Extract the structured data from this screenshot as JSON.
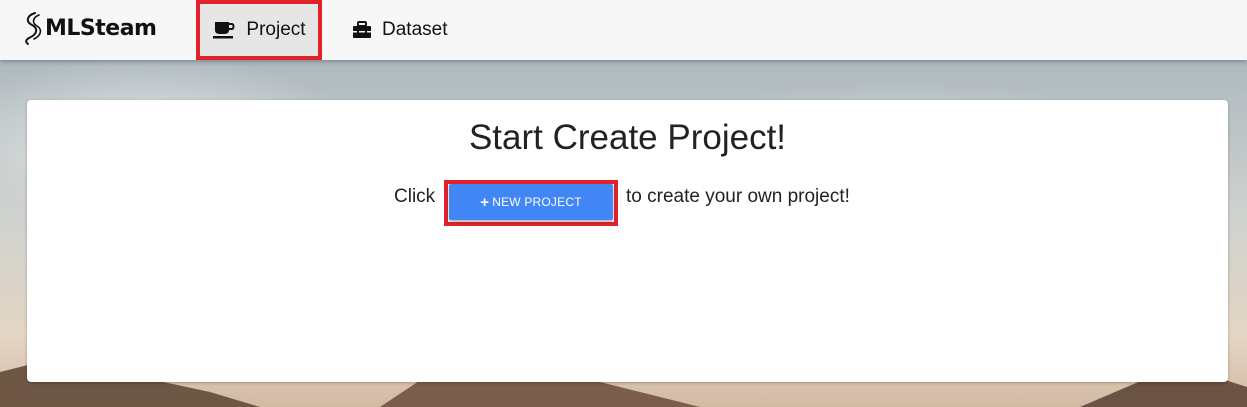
{
  "app": {
    "brand_name": "MLSteam",
    "brand_icon": "mlsteam-logo-icon"
  },
  "nav": {
    "items": [
      {
        "label": "Project",
        "icon": "coffee-cup-icon",
        "highlighted": true
      },
      {
        "label": "Dataset",
        "icon": "toolbox-icon",
        "highlighted": false
      }
    ]
  },
  "main": {
    "title": "Start Create Project!",
    "prompt_prefix": "Click",
    "new_project_button": {
      "icon": "plus-icon",
      "label": "NEW PROJECT"
    },
    "prompt_suffix": "to create your own project!"
  },
  "colors": {
    "navbar_bg": "#f7f7f7",
    "highlight_border": "#e0222b",
    "button_primary": "#4285f4",
    "card_bg": "#ffffff"
  }
}
